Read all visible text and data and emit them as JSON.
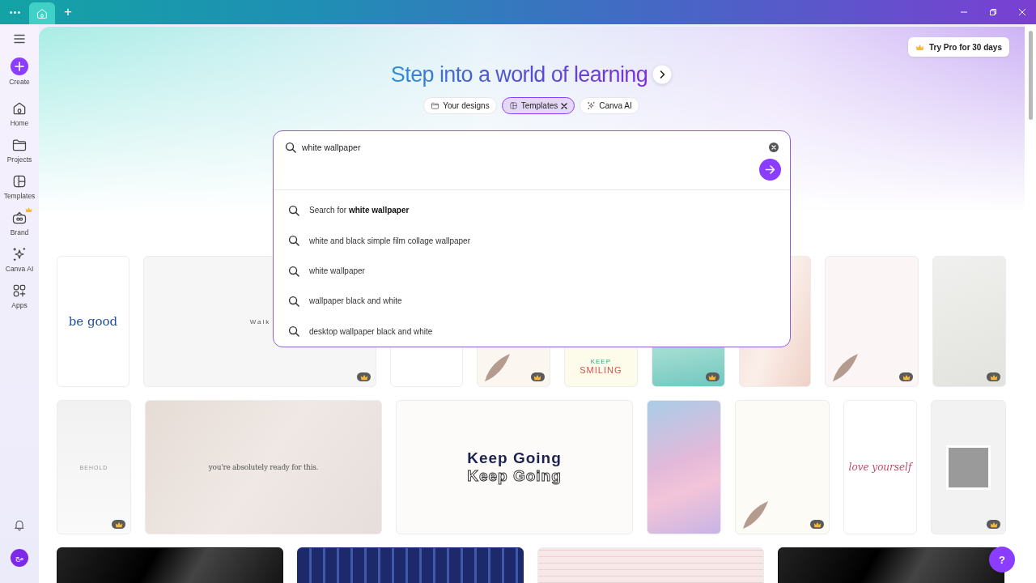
{
  "top_bar": {
    "menu": "•••",
    "tabs": [
      {
        "kind": "home",
        "selected": true
      }
    ],
    "new_tab": "+"
  },
  "sidebar": {
    "create": {
      "label": "Create"
    },
    "items": [
      {
        "kind": "home",
        "label": "Home",
        "premium": false
      },
      {
        "kind": "folder",
        "label": "Projects",
        "premium": false
      },
      {
        "kind": "templates",
        "label": "Templates",
        "premium": false
      },
      {
        "kind": "brand",
        "label": "Brand",
        "premium": true
      },
      {
        "kind": "sparkle",
        "label": "Canva AI",
        "premium": false
      },
      {
        "kind": "apps",
        "label": "Apps",
        "premium": false
      }
    ],
    "avatar": "مج"
  },
  "try_pro": {
    "label": "Try Pro for 30 days"
  },
  "heading": "Step into a world of learning",
  "filters": [
    {
      "kind": "folder",
      "label": "Your designs",
      "selected": false
    },
    {
      "kind": "templates",
      "label": "Templates",
      "selected": true
    },
    {
      "kind": "sparkle",
      "label": "Canva AI",
      "selected": false
    }
  ],
  "search": {
    "value": "white wallpaper",
    "suggestions": [
      "Search for **white wallpaper**",
      "white and black simple film collage wallpaper",
      "white wallpaper",
      "wallpaper black and white",
      "desktop wallpaper black and white"
    ]
  },
  "template_rows": [
    {
      "cards": [
        {
          "kind": "begood",
          "texts": [
            "be good"
          ],
          "premium": false
        },
        {
          "kind": "walk",
          "texts": [
            "Walk"
          ],
          "premium": true
        },
        {
          "kind": "plain",
          "premium": false
        },
        {
          "kind": "floral",
          "premium": true
        },
        {
          "kind": "smiling",
          "texts": [
            "KEEP",
            "SMILING"
          ],
          "premium": false
        },
        {
          "kind": "teal",
          "premium": true
        },
        {
          "kind": "blush",
          "premium": false
        },
        {
          "kind": "leaves",
          "premium": true
        },
        {
          "kind": "marble",
          "premium": true
        }
      ]
    },
    {
      "cards": [
        {
          "kind": "behold",
          "texts": [
            "BEHOLD"
          ],
          "premium": true
        },
        {
          "kind": "ready",
          "texts": [
            "you're absolutely ready for this."
          ],
          "premium": false
        },
        {
          "kind": "keepgoing",
          "texts": [
            "Keep Going",
            "Keep Going"
          ],
          "premium": false
        },
        {
          "kind": "pastel",
          "premium": false
        },
        {
          "kind": "sage",
          "premium": true
        },
        {
          "kind": "love",
          "texts": [
            "love yourself"
          ],
          "premium": false
        },
        {
          "kind": "photo",
          "premium": true
        }
      ]
    },
    {
      "cards": [
        {
          "kind": "black",
          "premium": false
        },
        {
          "kind": "knit",
          "premium": false
        },
        {
          "kind": "grid",
          "premium": false
        },
        {
          "kind": "black",
          "premium": false
        }
      ]
    }
  ],
  "help": "?"
}
